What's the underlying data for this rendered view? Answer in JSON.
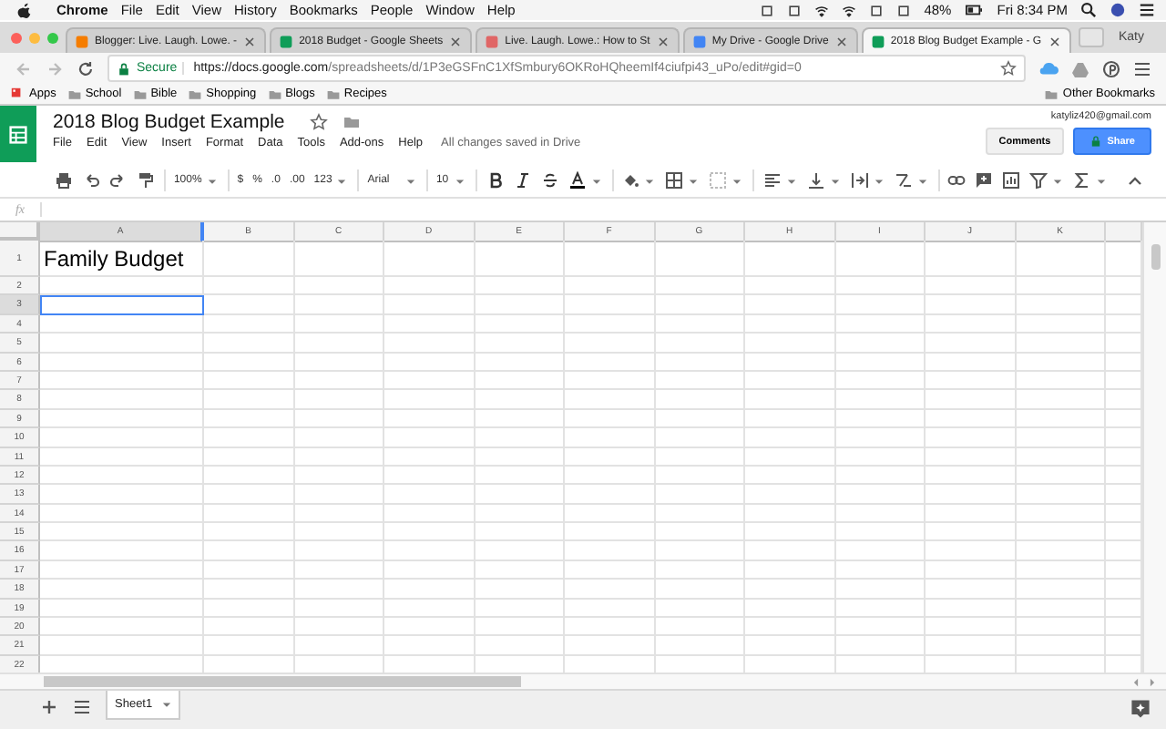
{
  "mac_menubar": {
    "app": "Chrome",
    "menus": [
      "File",
      "Edit",
      "View",
      "History",
      "Bookmarks",
      "People",
      "Window",
      "Help"
    ],
    "battery": "48%",
    "clock": "Fri 8:34 PM"
  },
  "browser_tabs": [
    {
      "title": "Blogger: Live. Laugh. Lowe. -",
      "selected": false,
      "color": "#f57d00"
    },
    {
      "title": "2018 Budget - Google Sheets",
      "selected": false,
      "color": "#0f9d58"
    },
    {
      "title": "Live. Laugh. Lowe.: How to St",
      "selected": false,
      "color": "#e06666"
    },
    {
      "title": "My Drive - Google Drive",
      "selected": false,
      "color": "#4285f4"
    },
    {
      "title": "2018 Blog Budget Example - G",
      "selected": true,
      "color": "#0f9d58"
    }
  ],
  "profile": "Katy",
  "address_bar": {
    "secure": "Secure",
    "url_host": "https://docs.google.com",
    "url_path": "/spreadsheets/d/1P3eGSFnC1XfSmbury6OKRoHQheemIf4ciufpi43_uPo/edit#gid=0"
  },
  "bookmarks": [
    "Apps",
    "School",
    "Bible",
    "Shopping",
    "Blogs",
    "Recipes"
  ],
  "other_bookmarks": "Other Bookmarks",
  "doc": {
    "title": "2018 Blog Budget Example",
    "menus": [
      "File",
      "Edit",
      "View",
      "Insert",
      "Format",
      "Data",
      "Tools",
      "Add-ons",
      "Help"
    ],
    "save_status": "All changes saved in Drive",
    "account": "katyliz420@gmail.com",
    "comments": "Comments",
    "share": "Share"
  },
  "toolbar": {
    "zoom": "100%",
    "currency": "$",
    "percent": "%",
    "decrease_decimals": ".0",
    "increase_decimals": ".00",
    "number_format": "123",
    "font": "Arial",
    "font_size": "10"
  },
  "formula_bar": {
    "label": "fx"
  },
  "columns": [
    {
      "label": "A",
      "selected": true
    },
    {
      "label": "B",
      "selected": false
    },
    {
      "label": "C",
      "selected": false
    },
    {
      "label": "D",
      "selected": false
    },
    {
      "label": "E",
      "selected": false
    },
    {
      "label": "F",
      "selected": false
    },
    {
      "label": "G",
      "selected": false
    },
    {
      "label": "H",
      "selected": false
    },
    {
      "label": "I",
      "selected": false
    },
    {
      "label": "J",
      "selected": false
    },
    {
      "label": "K",
      "selected": false
    }
  ],
  "rows": [
    {
      "label": "1",
      "selected": false,
      "cells": [
        "Family Budget"
      ]
    },
    {
      "label": "2",
      "selected": false
    },
    {
      "label": "3",
      "selected": true
    },
    {
      "label": "4",
      "selected": false
    },
    {
      "label": "5",
      "selected": false
    },
    {
      "label": "6",
      "selected": false
    },
    {
      "label": "7",
      "selected": false
    },
    {
      "label": "8",
      "selected": false
    },
    {
      "label": "9",
      "selected": false
    },
    {
      "label": "10",
      "selected": false
    },
    {
      "label": "11",
      "selected": false
    },
    {
      "label": "12",
      "selected": false
    },
    {
      "label": "13",
      "selected": false
    },
    {
      "label": "14",
      "selected": false
    },
    {
      "label": "15",
      "selected": false
    },
    {
      "label": "16",
      "selected": false
    },
    {
      "label": "17",
      "selected": false
    },
    {
      "label": "18",
      "selected": false
    },
    {
      "label": "19",
      "selected": false
    },
    {
      "label": "20",
      "selected": false
    },
    {
      "label": "21",
      "selected": false
    },
    {
      "label": "22",
      "selected": false
    }
  ],
  "sheet_tabs": [
    {
      "label": "Sheet1",
      "selected": true
    }
  ]
}
